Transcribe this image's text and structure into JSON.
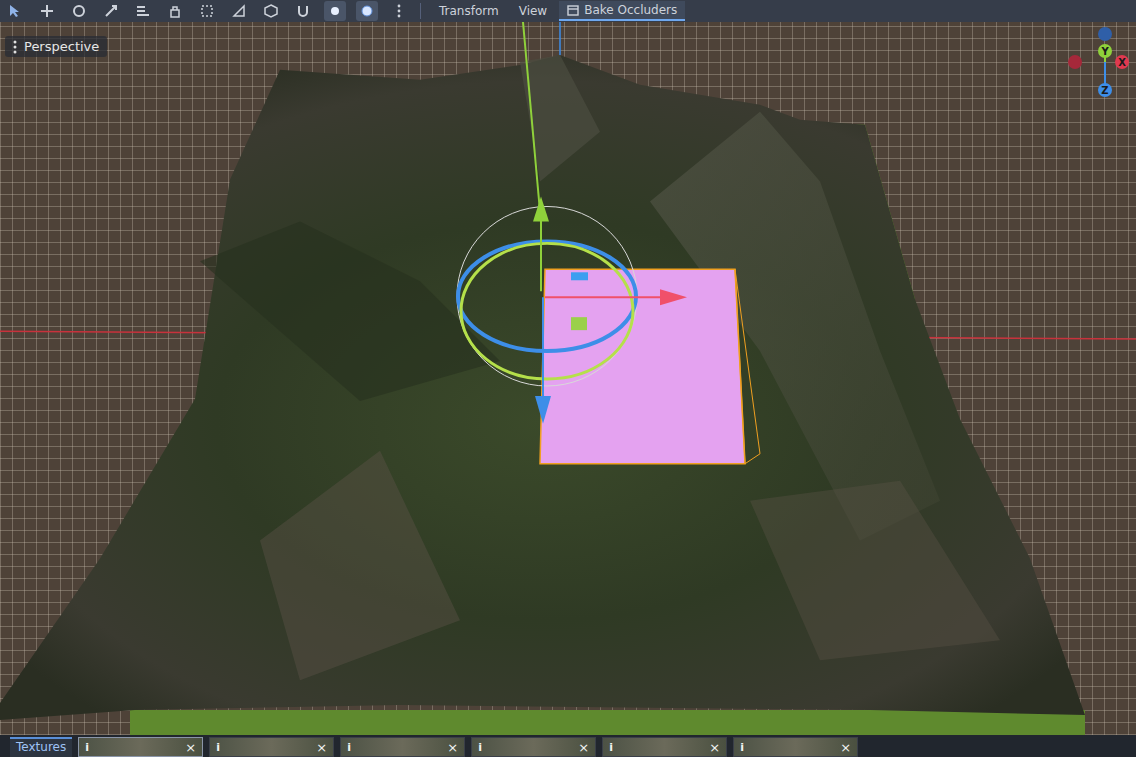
{
  "toolbar": {
    "menus": [
      {
        "label": "Transform",
        "selected": false
      },
      {
        "label": "View",
        "selected": false
      }
    ],
    "bake_button": {
      "label": "Bake Occluders",
      "selected": true
    }
  },
  "viewport": {
    "view_label": "Perspective",
    "gizmo_axes": [
      {
        "label": "Y",
        "color": "#8fd13b"
      },
      {
        "label": "Z",
        "color": "#3d8ee8"
      },
      {
        "label": "X",
        "color": "#e0394f"
      }
    ]
  },
  "bottom_panel": {
    "title": "Textures",
    "tabs": [
      {
        "label": "i",
        "close": "×",
        "selected": true
      },
      {
        "label": "i",
        "close": "×",
        "selected": false
      },
      {
        "label": "i",
        "close": "×",
        "selected": false
      },
      {
        "label": "i",
        "close": "×",
        "selected": false
      },
      {
        "label": "i",
        "close": "×",
        "selected": false
      },
      {
        "label": "i",
        "close": "×",
        "selected": false
      }
    ]
  }
}
